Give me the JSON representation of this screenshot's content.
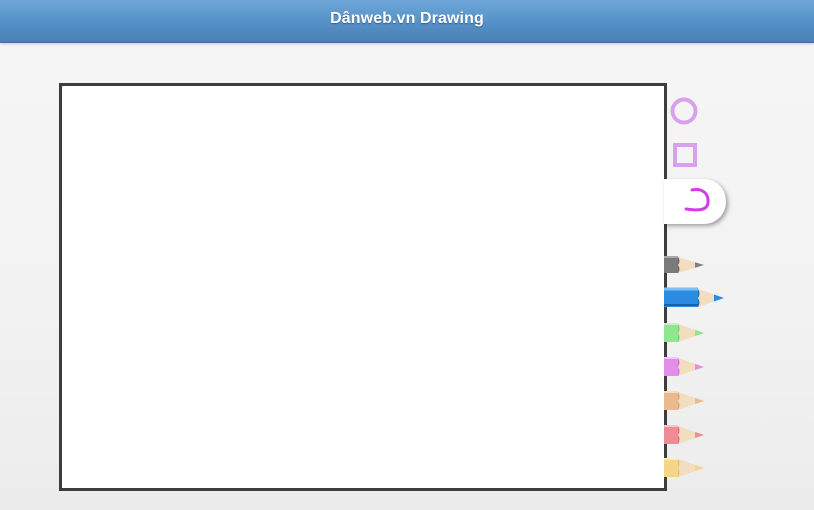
{
  "header": {
    "title": "Dânweb.vn Drawing"
  },
  "tools": [
    {
      "name": "circle-tool",
      "icon": "circle-icon",
      "color": "#d9a0ee"
    },
    {
      "name": "rectangle-tool",
      "icon": "square-icon",
      "color": "#d9a0ee"
    },
    {
      "name": "freehand-tool",
      "icon": "freehand-line-icon",
      "color": "#d23ee6",
      "selected": true
    }
  ],
  "colors": {
    "header_gradient_top": "#6fa8d8",
    "header_gradient_bottom": "#4a80b6",
    "canvas_border": "#3d3d3d",
    "canvas_background": "#ffffff"
  },
  "pencils": [
    {
      "name": "gray",
      "color": "#808080",
      "selected": false
    },
    {
      "name": "blue",
      "color": "#2a8be0",
      "selected": true
    },
    {
      "name": "green",
      "color": "#8ee68e",
      "selected": false
    },
    {
      "name": "violet",
      "color": "#e08ee8",
      "selected": false
    },
    {
      "name": "tan",
      "color": "#eab98e",
      "selected": false
    },
    {
      "name": "pink",
      "color": "#f08a94",
      "selected": false
    },
    {
      "name": "yellow",
      "color": "#f6d58a",
      "selected": false
    }
  ]
}
